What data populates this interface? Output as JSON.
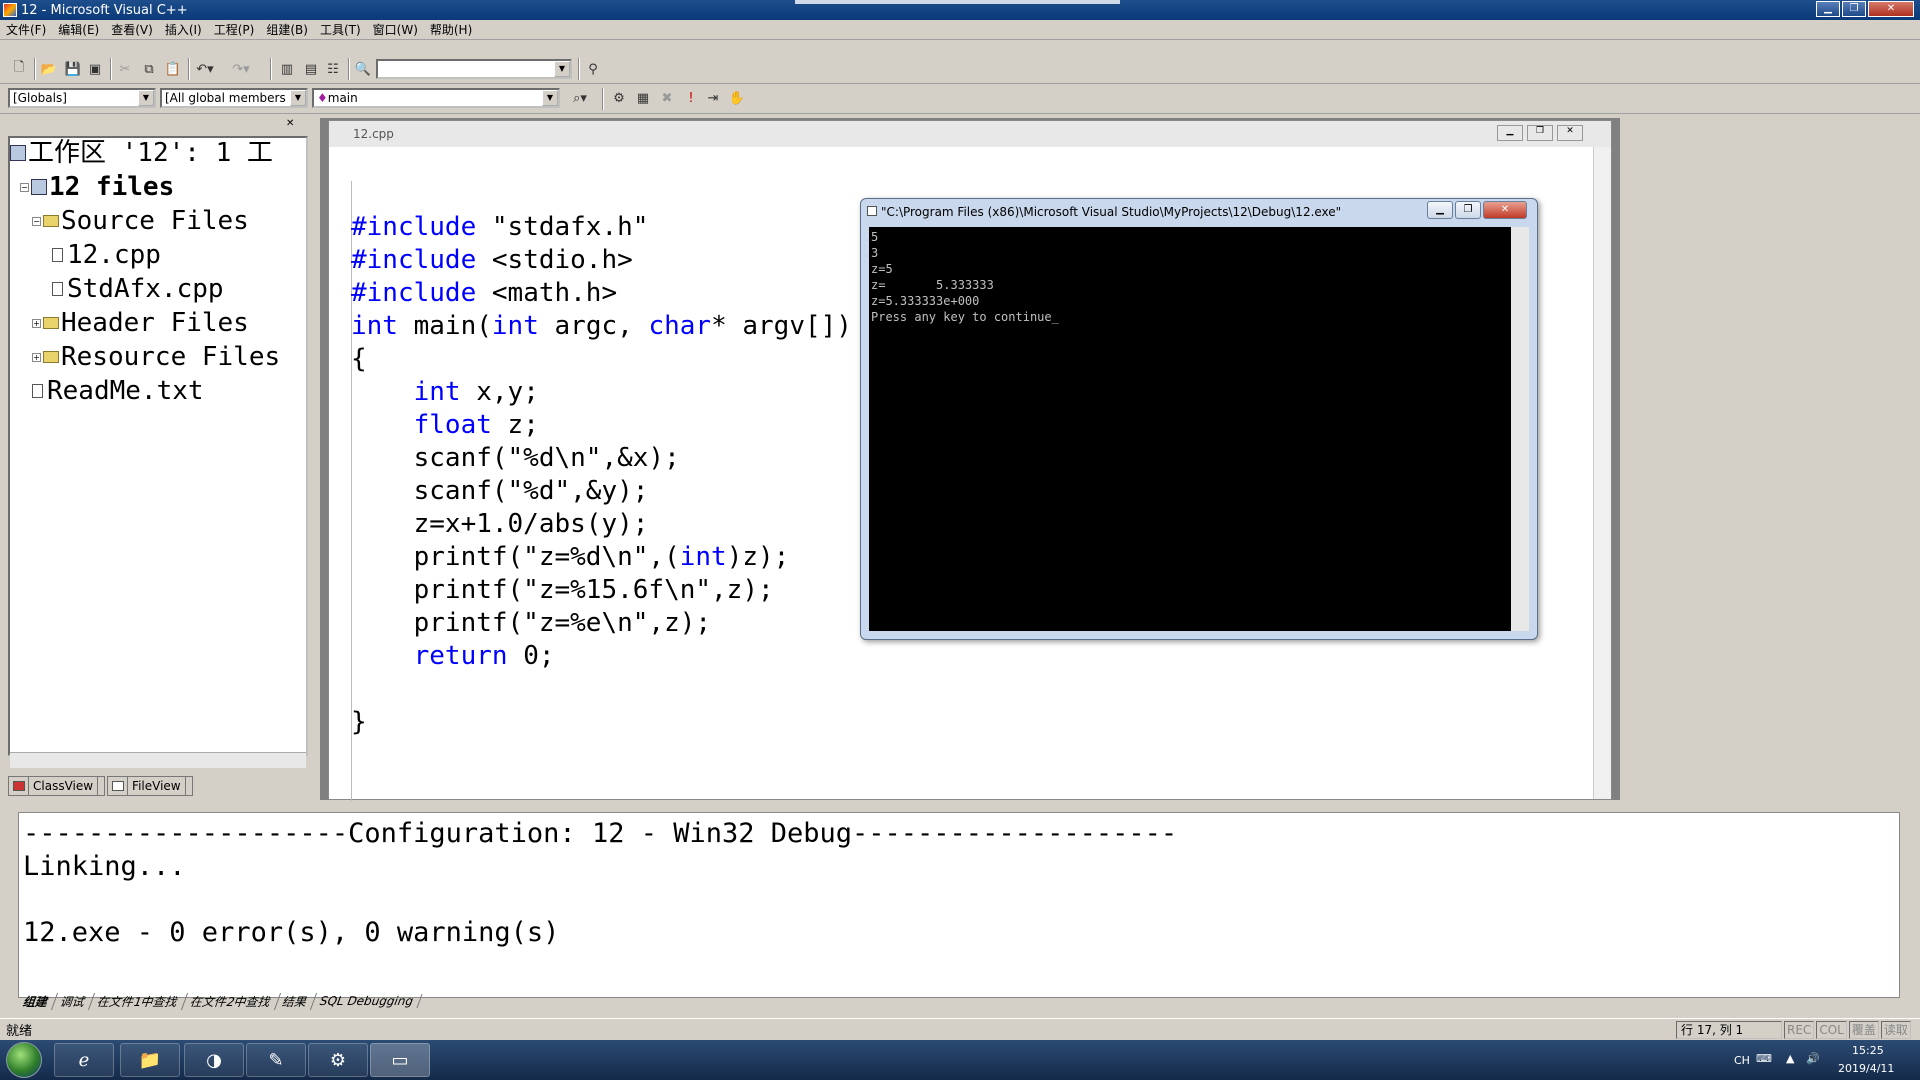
{
  "window": {
    "title": "12 - Microsoft Visual C++"
  },
  "menu": [
    "文件(F)",
    "编辑(E)",
    "查看(V)",
    "插入(I)",
    "工程(P)",
    "组建(B)",
    "工具(T)",
    "窗口(W)",
    "帮助(H)"
  ],
  "toolbar2": {
    "globals": "[Globals]",
    "members": "[All global members",
    "function": "main"
  },
  "workspace": {
    "tree": [
      {
        "label": "工作区 '12': 1 工",
        "level": 0,
        "kind": "workspace"
      },
      {
        "label": "12 files",
        "level": 1,
        "kind": "project",
        "bold": true
      },
      {
        "label": "Source Files",
        "level": 2,
        "kind": "folder"
      },
      {
        "label": "12.cpp",
        "level": 3,
        "kind": "file"
      },
      {
        "label": "StdAfx.cpp",
        "level": 3,
        "kind": "file"
      },
      {
        "label": "Header Files",
        "level": 2,
        "kind": "folder"
      },
      {
        "label": "Resource Files",
        "level": 2,
        "kind": "folder"
      },
      {
        "label": "ReadMe.txt",
        "level": 2,
        "kind": "file"
      }
    ],
    "tabs": [
      "ClassView",
      "FileView"
    ]
  },
  "editor": {
    "tab": "12.cpp",
    "lines": [
      [
        {
          "t": "#include",
          "k": 1
        },
        {
          "t": " \"stdafx.h\""
        }
      ],
      [
        {
          "t": "#include",
          "k": 1
        },
        {
          "t": " <stdio.h>"
        }
      ],
      [
        {
          "t": "#include",
          "k": 1
        },
        {
          "t": " <math.h>"
        }
      ],
      [
        {
          "t": "int",
          "k": 1
        },
        {
          "t": " main("
        },
        {
          "t": "int",
          "k": 1
        },
        {
          "t": " argc, "
        },
        {
          "t": "char",
          "k": 1
        },
        {
          "t": "* argv[])"
        }
      ],
      [
        {
          "t": "{"
        }
      ],
      [
        {
          "t": "    "
        },
        {
          "t": "int",
          "k": 1
        },
        {
          "t": " x,y;"
        }
      ],
      [
        {
          "t": "    "
        },
        {
          "t": "float",
          "k": 1
        },
        {
          "t": " z;"
        }
      ],
      [
        {
          "t": "    scanf(\"%d\\n\",&x);"
        }
      ],
      [
        {
          "t": "    scanf(\"%d\",&y);"
        }
      ],
      [
        {
          "t": "    z=x+1.0/abs(y);"
        }
      ],
      [
        {
          "t": "    printf(\"z=%d\\n\",("
        },
        {
          "t": "int",
          "k": 1
        },
        {
          "t": ")z);"
        }
      ],
      [
        {
          "t": "    printf(\"z=%15.6f\\n\",z);"
        }
      ],
      [
        {
          "t": "    printf(\"z=%e\\n\",z);"
        }
      ],
      [
        {
          "t": "    "
        },
        {
          "t": "return",
          "k": 1
        },
        {
          "t": " 0;"
        }
      ],
      [
        {
          "t": ""
        }
      ],
      [
        {
          "t": "}"
        }
      ]
    ]
  },
  "console": {
    "title": "\"C:\\Program Files (x86)\\Microsoft Visual Studio\\MyProjects\\12\\Debug\\12.exe\"",
    "lines": [
      "5",
      "3",
      "z=5",
      "z=       5.333333",
      "z=5.333333e+000",
      "Press any key to continue_"
    ]
  },
  "output": {
    "lines": [
      "--------------------Configuration: 12 - Win32 Debug--------------------",
      "Linking...",
      "",
      "12.exe - 0 error(s), 0 warning(s)"
    ],
    "tabs": [
      "组建",
      "调试",
      "在文件1中查找",
      "在文件2中查找",
      "结果",
      "SQL Debugging"
    ]
  },
  "status": {
    "ready": "就绪",
    "position": "行 17, 列 1",
    "indicators": [
      "REC",
      "COL",
      "覆盖",
      "读取"
    ]
  },
  "taskbar": {
    "ime": "CH",
    "time": "15:25",
    "date": "2019/4/11"
  }
}
